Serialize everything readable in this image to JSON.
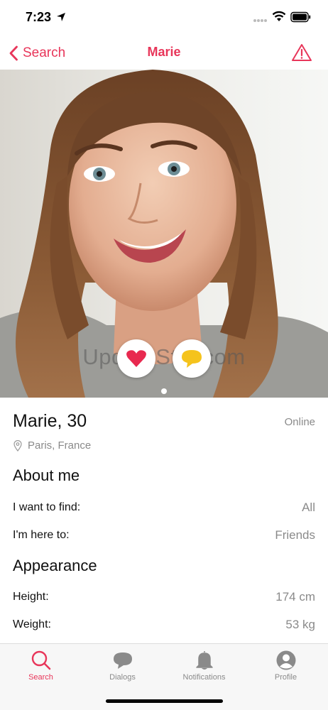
{
  "status_bar": {
    "time": "7:23"
  },
  "nav": {
    "back_label": "Search",
    "title": "Marie"
  },
  "photo": {
    "watermark": "UpdateStar.com",
    "page_count": 1,
    "current_page": 1
  },
  "profile": {
    "name_age": "Marie, 30",
    "status": "Online",
    "location": "Paris, France"
  },
  "about": {
    "title": "About me",
    "rows": [
      {
        "label": "I want to find:",
        "value": "All"
      },
      {
        "label": "I'm here to:",
        "value": "Friends"
      }
    ]
  },
  "appearance": {
    "title": "Appearance",
    "rows": [
      {
        "label": "Height:",
        "value": "174 cm"
      },
      {
        "label": "Weight:",
        "value": "53 kg"
      }
    ]
  },
  "tabs": [
    {
      "label": "Search",
      "icon": "search-icon",
      "active": true
    },
    {
      "label": "Dialogs",
      "icon": "chat-bubble-icon",
      "active": false
    },
    {
      "label": "Notifications",
      "icon": "bell-icon",
      "active": false
    },
    {
      "label": "Profile",
      "icon": "person-icon",
      "active": false
    }
  ],
  "colors": {
    "accent": "#e8365a",
    "secondary_text": "#8a8a8a",
    "tab_bar_bg": "#f7f7f7",
    "chat_yellow": "#f5c31c"
  }
}
